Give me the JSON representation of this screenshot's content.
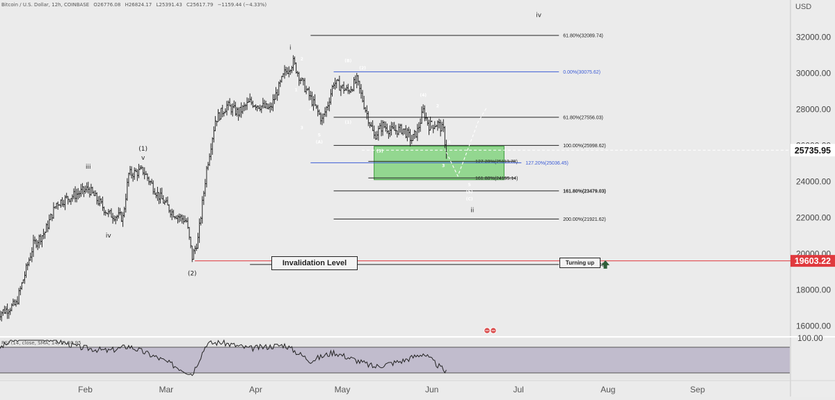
{
  "header": {
    "symbol": "Bitcoin / U.S. Dollar, 12h, COINBASE",
    "open": "O26776.08",
    "high": "H26824.17",
    "low": "L25391.43",
    "close": "C25617.79",
    "change": "−1159.44 (−4.33%)"
  },
  "rsi_label": "RSI (14, close, SMA, 14, 2)  30.95",
  "currency_label": "USD",
  "invalidation_label": "Invalidation Level",
  "turning_label": "Turning up",
  "colors": {
    "background": "#ebebeb",
    "candle": "#222222",
    "fib_black": "#222222",
    "fib_blue": "#3b5bd6",
    "red_line": "#e0393e",
    "zone_fill": "#7fd27b",
    "zone_border": "#3a9a3a",
    "price_badge_dark": "#111111",
    "price_badge_red": "#e0393e",
    "rsi_band": "#b4aec4",
    "arrow": "#2f5d39"
  },
  "chart_data": {
    "type": "candlestick",
    "instrument": "Bitcoin / U.S. Dollar",
    "timeframe": "12h",
    "ylim": [
      15000,
      34000
    ],
    "y_ticks": [
      16000,
      18000,
      20000,
      22000,
      24000,
      26000,
      28000,
      30000,
      32000
    ],
    "y_tick_labels": [
      "16000.00",
      "18000.00",
      "20000.00",
      "22000.00",
      "24000.00",
      "26000.00",
      "28000.00",
      "30000.00",
      "32000.00"
    ],
    "x_labels": [
      "Feb",
      "Mar",
      "Apr",
      "May",
      "Jun",
      "Jul",
      "Aug",
      "Sep"
    ],
    "price_path": [
      [
        "2023-01-01",
        16600
      ],
      [
        "2023-01-08",
        17200
      ],
      [
        "2023-01-14",
        20500
      ],
      [
        "2023-01-18",
        21200
      ],
      [
        "2023-01-22",
        22800
      ],
      [
        "2023-01-29",
        23300
      ],
      [
        "2023-02-02",
        23600
      ],
      [
        "2023-02-09",
        22200
      ],
      [
        "2023-02-14",
        22000
      ],
      [
        "2023-02-16",
        24400
      ],
      [
        "2023-02-21",
        24600
      ],
      [
        "2023-02-26",
        23300
      ],
      [
        "2023-03-03",
        22300
      ],
      [
        "2023-03-08",
        21800
      ],
      [
        "2023-03-10",
        19800
      ],
      [
        "2023-03-12",
        20800
      ],
      [
        "2023-03-15",
        24700
      ],
      [
        "2023-03-18",
        27400
      ],
      [
        "2023-03-22",
        28200
      ],
      [
        "2023-03-26",
        27800
      ],
      [
        "2023-03-30",
        28400
      ],
      [
        "2023-04-06",
        28000
      ],
      [
        "2023-04-11",
        30000
      ],
      [
        "2023-04-14",
        30600
      ],
      [
        "2023-04-17",
        29500
      ],
      [
        "2023-04-20",
        28600
      ],
      [
        "2023-04-24",
        27400
      ],
      [
        "2023-04-26",
        28300
      ],
      [
        "2023-04-28",
        29500
      ],
      [
        "2023-05-03",
        29000
      ],
      [
        "2023-05-06",
        29600
      ],
      [
        "2023-05-09",
        28000
      ],
      [
        "2023-05-12",
        26500
      ],
      [
        "2023-05-15",
        27100
      ],
      [
        "2023-05-18",
        26800
      ],
      [
        "2023-05-22",
        26900
      ],
      [
        "2023-05-25",
        26300
      ],
      [
        "2023-05-27",
        26800
      ],
      [
        "2023-05-29",
        27900
      ],
      [
        "2023-05-31",
        27100
      ],
      [
        "2023-06-03",
        27200
      ],
      [
        "2023-06-05",
        26800
      ],
      [
        "2023-06-06",
        25618
      ]
    ],
    "rsi": {
      "label": "RSI (14, close, SMA, 14, 2)",
      "value": 30.95,
      "path": [
        [
          "2023-01-01",
          68
        ],
        [
          "2023-01-10",
          90
        ],
        [
          "2023-01-20",
          86
        ],
        [
          "2023-01-30",
          72
        ],
        [
          "2023-02-09",
          66
        ],
        [
          "2023-02-16",
          74
        ],
        [
          "2023-02-26",
          55
        ],
        [
          "2023-03-10",
          28
        ],
        [
          "2023-03-15",
          78
        ],
        [
          "2023-03-20",
          80
        ],
        [
          "2023-03-30",
          70
        ],
        [
          "2023-04-11",
          76
        ],
        [
          "2023-04-20",
          50
        ],
        [
          "2023-04-28",
          64
        ],
        [
          "2023-05-12",
          40
        ],
        [
          "2023-05-22",
          50
        ],
        [
          "2023-05-29",
          62
        ],
        [
          "2023-06-06",
          31
        ]
      ]
    },
    "fib_levels": [
      {
        "label": "61.80%(32089.74)",
        "price": 32089.74,
        "color": "black",
        "from": "2023-04-20",
        "to": "2023-07-15"
      },
      {
        "label": "0.00%(30075.62)",
        "price": 30075.62,
        "color": "blue",
        "from": "2023-04-28",
        "to": "2023-07-15"
      },
      {
        "label": "61.80%(27556.03)",
        "price": 27556.03,
        "color": "black",
        "from": "2023-04-28",
        "to": "2023-07-15"
      },
      {
        "label": "100.00%(25998.62)",
        "price": 25998.62,
        "color": "black",
        "from": "2023-04-28",
        "to": "2023-07-15"
      },
      {
        "label": "127.20%(25113.78)",
        "price": 25113.78,
        "color": "black",
        "from": "2023-05-10",
        "to": "2023-06-30"
      },
      {
        "label": "127.20%(25036.45)",
        "price": 25036.45,
        "color": "blue",
        "from": "2023-04-20",
        "to": "2023-07-02"
      },
      {
        "label": "161.80%(24195.14)",
        "price": 24195.14,
        "color": "black",
        "from": "2023-05-10",
        "to": "2023-06-30"
      },
      {
        "label": "161.80%(23479.03)",
        "price": 23479.03,
        "color": "black",
        "from": "2023-04-28",
        "to": "2023-07-15"
      },
      {
        "label": "200.00%(21921.62)",
        "price": 21921.62,
        "color": "black",
        "from": "2023-04-28",
        "to": "2023-07-15"
      },
      {
        "label": "261.80%(19402.03)",
        "price": 19402.03,
        "color": "black",
        "from": "2023-03-30",
        "to": "2023-07-15"
      }
    ],
    "current_price": {
      "label": "25735.95",
      "price": 25735.95
    },
    "red_level": {
      "label": "19603.22",
      "price": 19603.22
    },
    "target_zone": {
      "from": "2023-05-12",
      "to": "2023-06-26",
      "top": 25950,
      "bottom": 24100
    },
    "projection": [
      [
        "2023-06-06",
        25618
      ],
      [
        "2023-06-10",
        24300
      ],
      [
        "2023-06-17",
        27300
      ],
      [
        "2023-06-20",
        28100
      ]
    ],
    "wave_labels": [
      {
        "text": "iv",
        "date": "2023-07-08",
        "price": 33100,
        "size": 9
      },
      {
        "text": "i",
        "date": "2023-04-13",
        "price": 31300,
        "size": 9
      },
      {
        "text": "iii",
        "date": "2023-02-02",
        "price": 24700,
        "size": 9
      },
      {
        "text": "iv",
        "date": "2023-02-09",
        "price": 20900,
        "size": 9
      },
      {
        "text": "(1)",
        "date": "2023-02-21",
        "price": 25700,
        "size": 9
      },
      {
        "text": "v",
        "date": "2023-02-21",
        "price": 25200,
        "size": 9
      },
      {
        "text": "(2)",
        "date": "2023-03-10",
        "price": 18800,
        "size": 9
      },
      {
        "text": "ii",
        "date": "2023-06-15",
        "price": 22300,
        "size": 9
      },
      {
        "text": "2",
        "date": "2023-04-17",
        "price": 30700,
        "size": 6
      },
      {
        "text": "1",
        "date": "2023-04-15",
        "price": 29000,
        "size": 6
      },
      {
        "text": "4",
        "date": "2023-04-20",
        "price": 27900,
        "size": 6
      },
      {
        "text": "3",
        "date": "2023-04-17",
        "price": 26900,
        "size": 6
      },
      {
        "text": "5",
        "date": "2023-04-23",
        "price": 26500,
        "size": 6
      },
      {
        "text": "(A)",
        "date": "2023-04-23",
        "price": 26100,
        "size": 6
      },
      {
        "text": "(B)",
        "date": "2023-05-03",
        "price": 30600,
        "size": 6
      },
      {
        "text": "(2)",
        "date": "2023-05-08",
        "price": 30200,
        "size": 6
      },
      {
        "text": "(1)",
        "date": "2023-05-03",
        "price": 27200,
        "size": 6
      },
      {
        "text": "(3)",
        "date": "2023-05-14",
        "price": 25600,
        "size": 6
      },
      {
        "text": "(4)",
        "date": "2023-05-29",
        "price": 28700,
        "size": 6
      },
      {
        "text": "2",
        "date": "2023-06-03",
        "price": 28100,
        "size": 6
      },
      {
        "text": "1",
        "date": "2023-06-01",
        "price": 27100,
        "size": 6
      },
      {
        "text": "4",
        "date": "2023-06-07",
        "price": 26100,
        "size": 6
      },
      {
        "text": "3",
        "date": "2023-06-05",
        "price": 24800,
        "size": 6
      },
      {
        "text": "5",
        "date": "2023-06-14",
        "price": 23750,
        "size": 6
      },
      {
        "text": "(5)",
        "date": "2023-06-14",
        "price": 23350,
        "size": 6
      },
      {
        "text": "(C)",
        "date": "2023-06-14",
        "price": 22950,
        "size": 6
      }
    ]
  }
}
